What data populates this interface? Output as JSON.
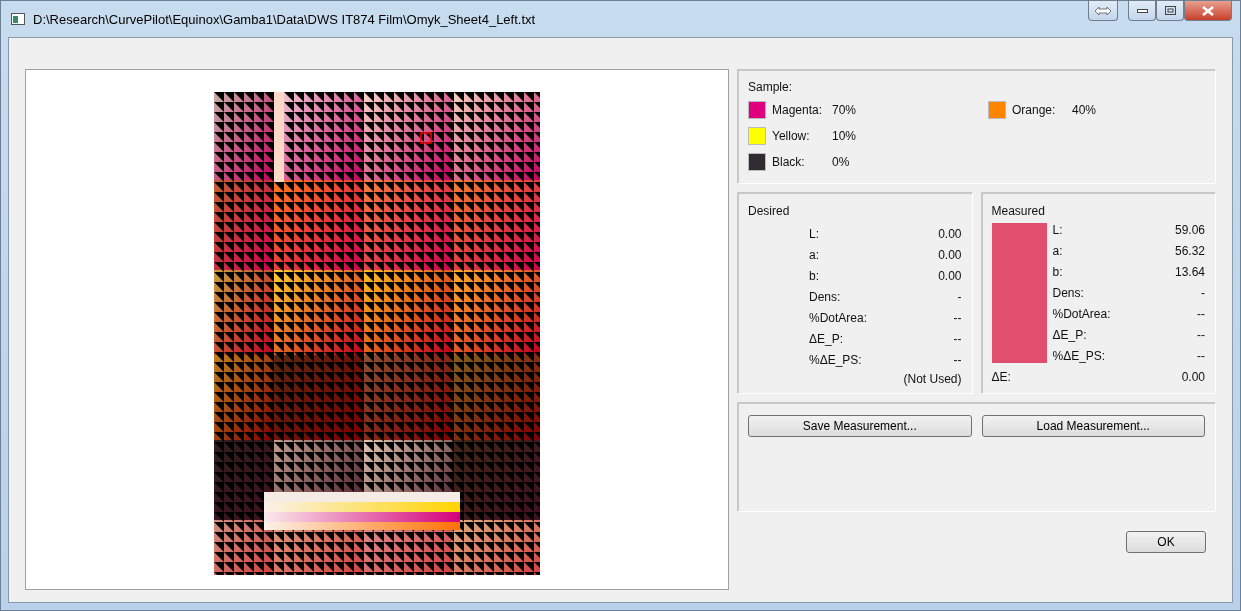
{
  "window": {
    "title": "D:\\Research\\CurvePilot\\Equinox\\Gamba1\\Data\\DWS IT874 Film\\Omyk_Sheet4_Left.txt"
  },
  "sample": {
    "label": "Sample:",
    "inks": [
      {
        "name": "Magenta:",
        "value": "70%",
        "color": "#e0007f"
      },
      {
        "name": "Yellow:",
        "value": "10%",
        "color": "#ffff00"
      },
      {
        "name": "Black:",
        "value": "0%",
        "color": "#2e2c30"
      },
      {
        "name": "Orange:",
        "value": "40%",
        "color": "#ff8400"
      }
    ]
  },
  "desired": {
    "title": "Desired",
    "rows": [
      {
        "label": "L:",
        "value": "0.00"
      },
      {
        "label": "a:",
        "value": "0.00"
      },
      {
        "label": "b:",
        "value": "0.00"
      },
      {
        "label": "Dens:",
        "value": "-"
      },
      {
        "label": "%DotArea:",
        "value": "--"
      },
      {
        "label": "ΔE_P:",
        "value": "--"
      },
      {
        "label": "%ΔE_PS:",
        "value": "--"
      }
    ],
    "note": "(Not Used)"
  },
  "measured": {
    "title": "Measured",
    "swatch": {
      "color": "#e04f6e"
    },
    "rows": [
      {
        "label": "L:",
        "value": "59.06"
      },
      {
        "label": "a:",
        "value": "56.32"
      },
      {
        "label": "b:",
        "value": "13.64"
      },
      {
        "label": "Dens:",
        "value": "-"
      },
      {
        "label": "%DotArea:",
        "value": "--"
      },
      {
        "label": "ΔE_P:",
        "value": "--"
      },
      {
        "label": "%ΔE_PS:",
        "value": "--"
      }
    ],
    "delta": {
      "label": "ΔE:",
      "value": "0.00"
    }
  },
  "buttons": [
    "Save Measurement...",
    "Load Measurement..."
  ],
  "ok": "OK"
}
